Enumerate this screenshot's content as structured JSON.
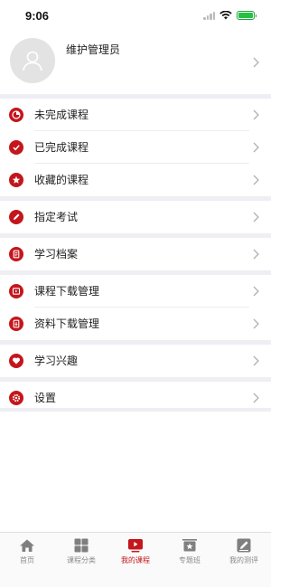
{
  "status_bar": {
    "time": "9:06"
  },
  "profile": {
    "name": "维护管理员"
  },
  "menu": [
    {
      "label": "未完成课程",
      "icon": "pie-chart-icon"
    },
    {
      "label": "已完成课程",
      "icon": "check-icon"
    },
    {
      "label": "收藏的课程",
      "icon": "star-icon"
    },
    {
      "label": "指定考试",
      "icon": "pencil-icon"
    },
    {
      "label": "学习档案",
      "icon": "archive-icon"
    },
    {
      "label": "课程下载管理",
      "icon": "video-download-icon"
    },
    {
      "label": "资料下载管理",
      "icon": "document-download-icon"
    },
    {
      "label": "学习兴趣",
      "icon": "heart-icon"
    },
    {
      "label": "设置",
      "icon": "settings-icon"
    }
  ],
  "tabbar": {
    "tabs": [
      {
        "label": "首页",
        "icon": "home-icon",
        "active": false
      },
      {
        "label": "课程分类",
        "icon": "grid-icon",
        "active": false
      },
      {
        "label": "我的课程",
        "icon": "play-icon",
        "active": true
      },
      {
        "label": "专题班",
        "icon": "class-board-icon",
        "active": false
      },
      {
        "label": "我的测评",
        "icon": "edit-icon",
        "active": false
      }
    ]
  },
  "colors": {
    "accent": "#c4161c",
    "separator": "#eeeef3",
    "tab_inactive": "#8a8a8a"
  }
}
